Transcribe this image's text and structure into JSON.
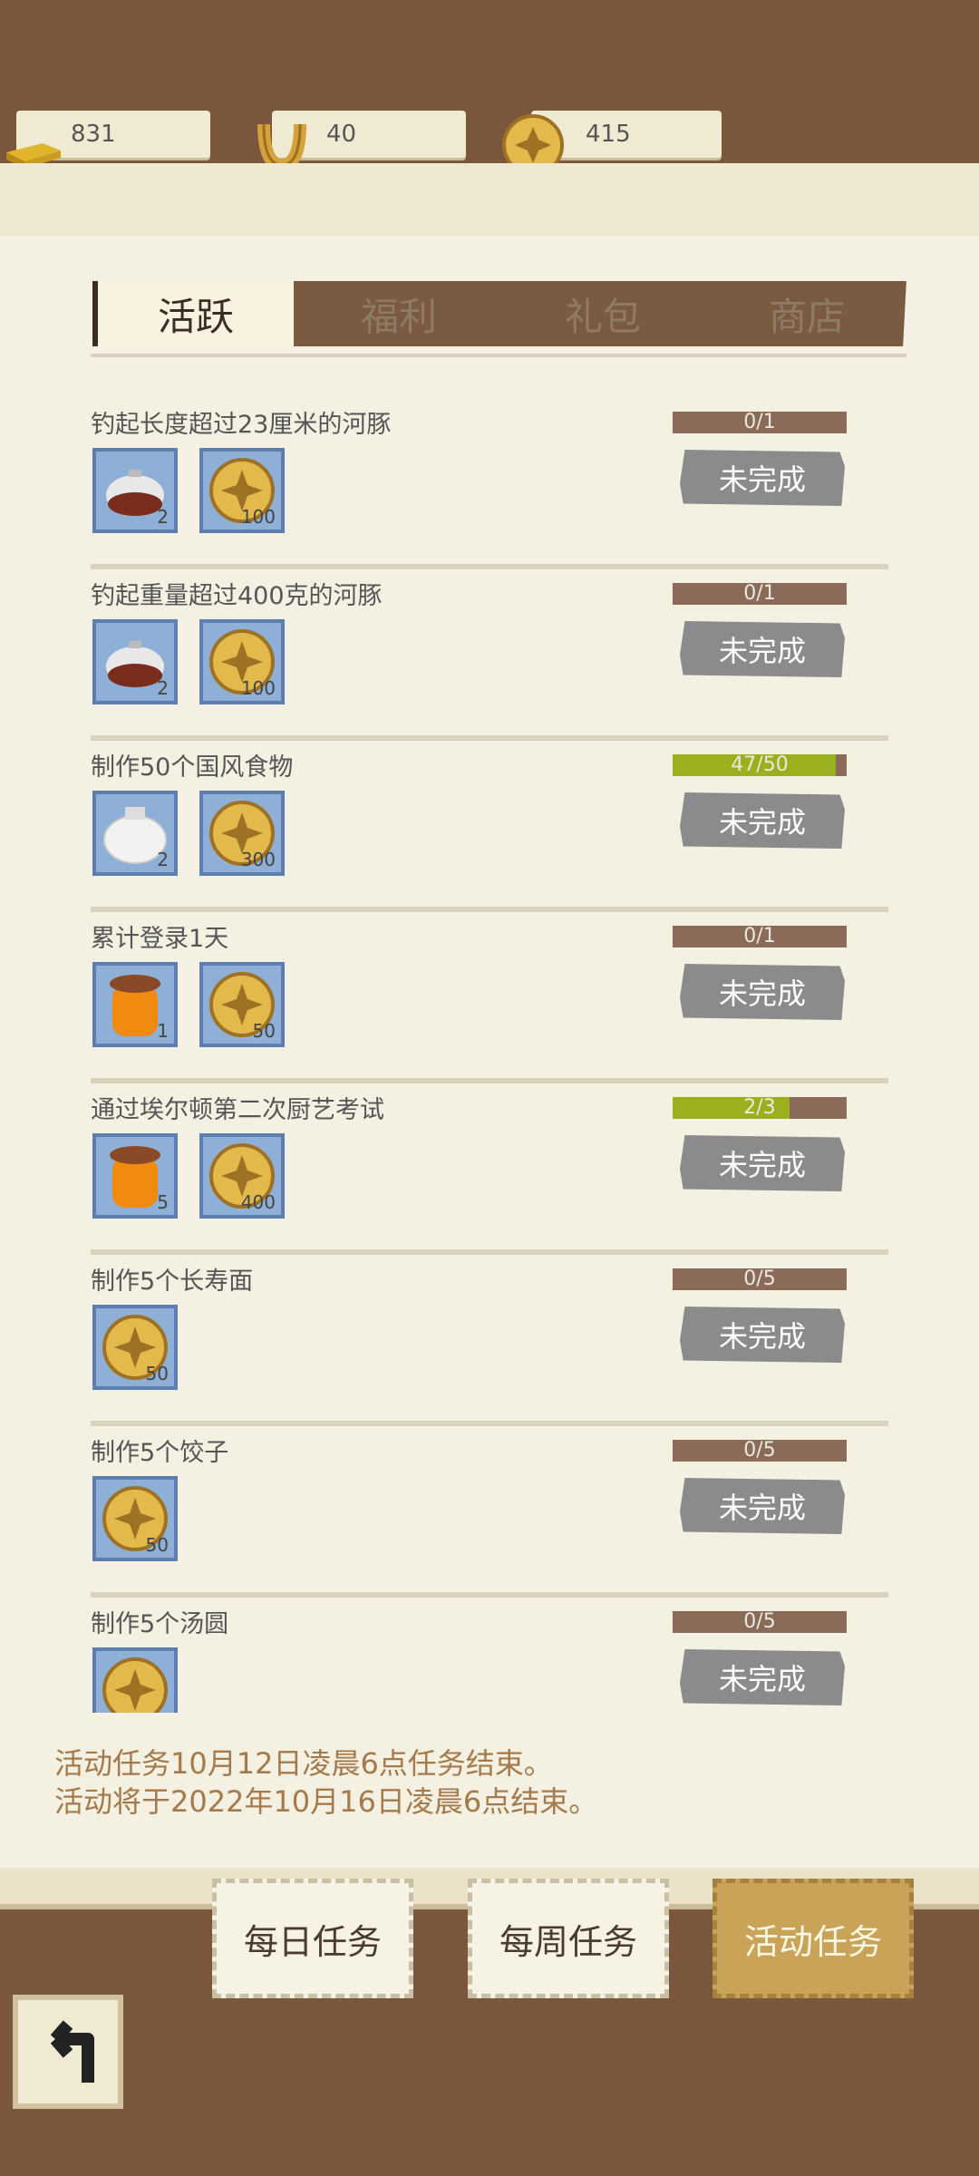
{
  "currency": [
    {
      "icon": "gold-bar-icon",
      "value": "831"
    },
    {
      "icon": "horseshoe-icon",
      "value": "40"
    },
    {
      "icon": "coin-icon",
      "value": "415"
    }
  ],
  "tabs": [
    "活跃",
    "福利",
    "礼包",
    "商店"
  ],
  "tasks": [
    {
      "title": "钓起长度超过23厘米的河豚",
      "progress_text": "0/1",
      "progress": 0.0,
      "rewards": [
        {
          "icon": "teapot-icon",
          "count": "2"
        },
        {
          "icon": "coin-icon",
          "count": "100"
        }
      ],
      "status": "未完成"
    },
    {
      "title": "钓起重量超过400克的河豚",
      "progress_text": "0/1",
      "progress": 0.0,
      "rewards": [
        {
          "icon": "teapot-icon",
          "count": "2"
        },
        {
          "icon": "coin-icon",
          "count": "100"
        }
      ],
      "status": "未完成"
    },
    {
      "title": "制作50个国风食物",
      "progress_text": "47/50",
      "progress": 0.94,
      "rewards": [
        {
          "icon": "jar-icon",
          "count": "2"
        },
        {
          "icon": "coin-icon",
          "count": "300"
        }
      ],
      "status": "未完成"
    },
    {
      "title": "累计登录1天",
      "progress_text": "0/1",
      "progress": 0.0,
      "rewards": [
        {
          "icon": "honey-jar-icon",
          "count": "1"
        },
        {
          "icon": "coin-icon",
          "count": "50"
        }
      ],
      "status": "未完成"
    },
    {
      "title": "通过埃尔顿第二次厨艺考试",
      "progress_text": "2/3",
      "progress": 0.67,
      "rewards": [
        {
          "icon": "honey-jar-icon",
          "count": "5"
        },
        {
          "icon": "coin-icon",
          "count": "400"
        }
      ],
      "status": "未完成"
    },
    {
      "title": "制作5个长寿面",
      "progress_text": "0/5",
      "progress": 0.0,
      "rewards": [
        {
          "icon": "coin-icon",
          "count": "50"
        }
      ],
      "status": "未完成"
    },
    {
      "title": "制作5个饺子",
      "progress_text": "0/5",
      "progress": 0.0,
      "rewards": [
        {
          "icon": "coin-icon",
          "count": "50"
        }
      ],
      "status": "未完成"
    },
    {
      "title": "制作5个汤圆",
      "progress_text": "0/5",
      "progress": 0.0,
      "rewards": [
        {
          "icon": "coin-icon",
          "count": ""
        }
      ],
      "status": "未完成"
    }
  ],
  "notice": [
    "活动任务10月12日凌晨6点任务结束。",
    "活动将于2022年10月16日凌晨6点结束。"
  ],
  "bottom_tabs": [
    "每日任务",
    "每周任务",
    "活动任务"
  ],
  "colors": {
    "progress_bg": "#8a6b58",
    "progress_fill": "#9bb01c",
    "active_tab": "#c9a458"
  }
}
